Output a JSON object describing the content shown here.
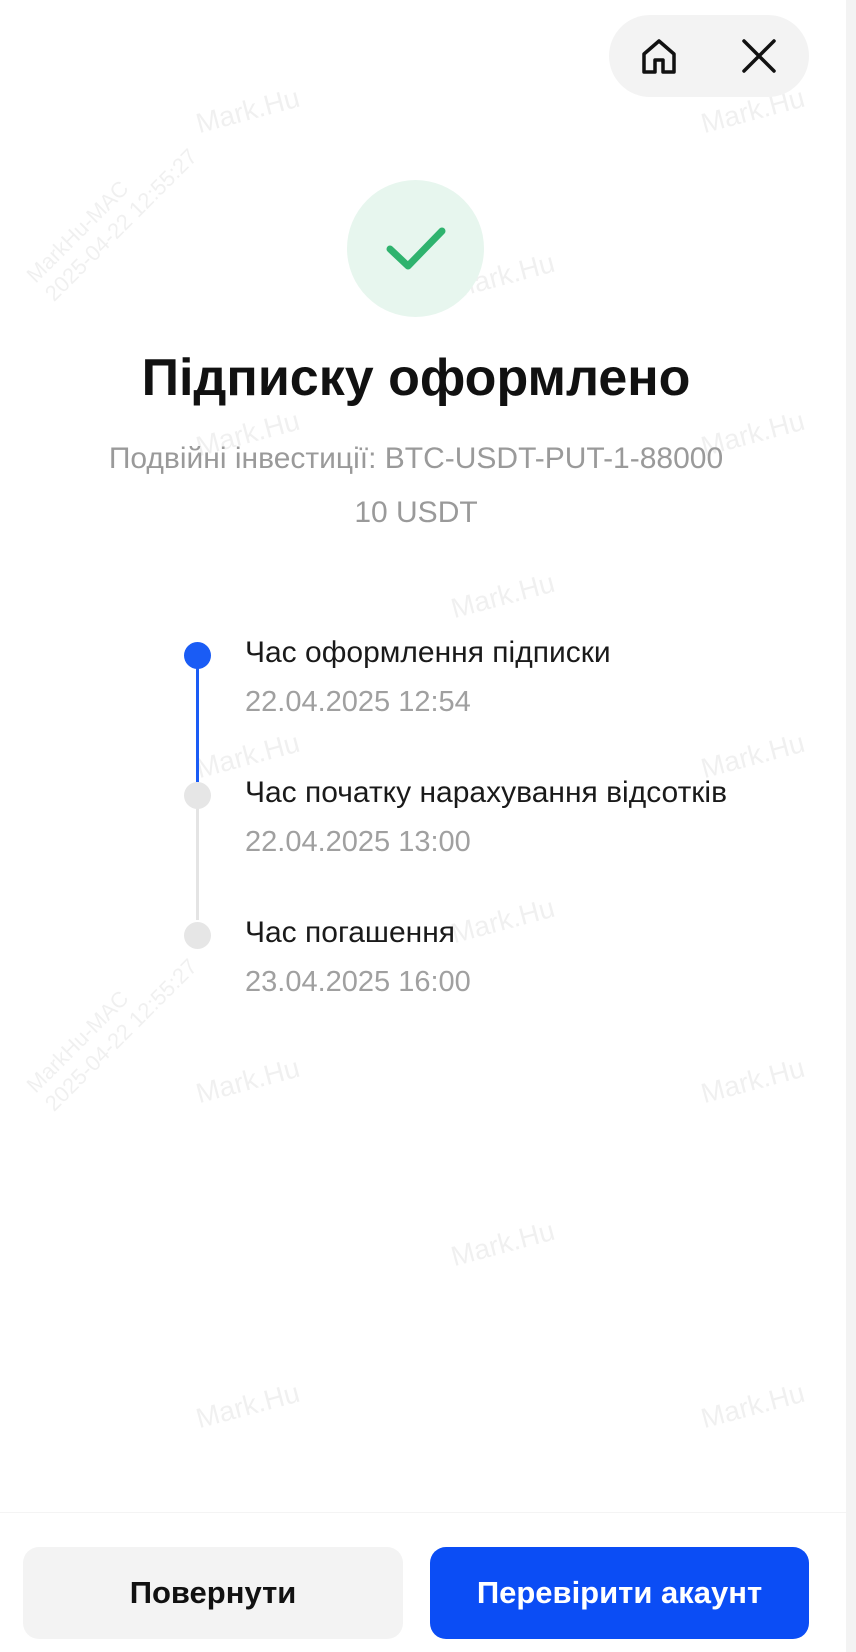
{
  "header": {
    "home_icon": "home-icon",
    "close_icon": "close-icon"
  },
  "status": {
    "icon": "checkmark-icon",
    "accent_color": "#2fb36e",
    "title": "Підписку оформлено",
    "product_line": "Подвійні інвестиції: BTC-USDT-PUT-1-88000",
    "amount_line": "10 USDT"
  },
  "timeline": {
    "items": [
      {
        "label": "Час оформлення підписки",
        "time": "22.04.2025 12:54",
        "state": "active"
      },
      {
        "label": "Час початку нарахування відсотків",
        "time": "22.04.2025 13:00",
        "state": "pending"
      },
      {
        "label": "Час погашення",
        "time": "23.04.2025 16:00",
        "state": "pending"
      }
    ],
    "active_color": "#1a5cf5",
    "pending_color": "#e6e6e6"
  },
  "actions": {
    "back_label": "Повернути",
    "check_account_label": "Перевірити акаунт",
    "primary_color": "#0b4df5"
  },
  "watermark": {
    "name": "Mark.Hu",
    "device": "MarkHu-MAC",
    "timestamp": "2025-04-22 12:55:27"
  }
}
